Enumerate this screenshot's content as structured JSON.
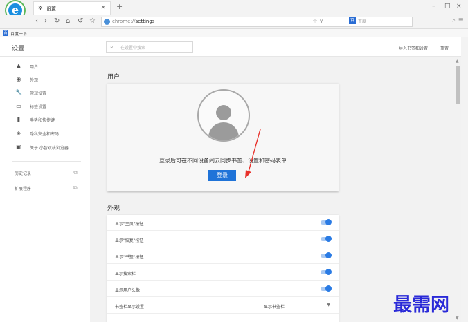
{
  "browser": {
    "tab_title": "设置",
    "tab_icon": "gear-icon",
    "new_tab": "+",
    "url_scheme": "chrome://",
    "url_path": "settings",
    "search_engine_label": "百",
    "search_placeholder": "百度",
    "bookmark_label": "百度一下",
    "bookmark_icon_text": "百",
    "logo_letter": "e"
  },
  "header": {
    "title": "设置",
    "search_placeholder": "在设置中搜索",
    "import_link": "导入书签和设置",
    "reset_link": "重置"
  },
  "sidebar": {
    "items": [
      {
        "label": "用户",
        "icon": "person-icon"
      },
      {
        "label": "外观",
        "icon": "palette-icon"
      },
      {
        "label": "常规设置",
        "icon": "wrench-icon"
      },
      {
        "label": "标签设置",
        "icon": "tab-icon"
      },
      {
        "label": "手势和快捷键",
        "icon": "mouse-icon"
      },
      {
        "label": "隐私安全和密码",
        "icon": "shield-icon"
      },
      {
        "label": "关于 小智双核浏览器",
        "icon": "info-icon"
      }
    ],
    "links": [
      {
        "label": "历史记录",
        "icon": "external-link-icon"
      },
      {
        "label": "扩展程序",
        "icon": "external-link-icon"
      }
    ]
  },
  "user_section": {
    "title": "用户",
    "prompt": "登录后可在不同设备间云同步书签、设置和密码表单",
    "login_button": "登录"
  },
  "appearance_section": {
    "title": "外观",
    "toggles": [
      {
        "label": "显示\"主页\"按钮",
        "on": true
      },
      {
        "label": "显示\"恢复\"按钮",
        "on": true
      },
      {
        "label": "显示\"书签\"按钮",
        "on": true
      },
      {
        "label": "显示搜索栏",
        "on": true
      },
      {
        "label": "显示用户头像",
        "on": true
      }
    ],
    "select_row": {
      "label": "书签栏显示设置",
      "value": "显示书签栏"
    }
  },
  "watermark": "最需网",
  "colors": {
    "accent": "#1f73d8",
    "toggle_on": "#2a7be4",
    "arrow": "#e8302a"
  }
}
